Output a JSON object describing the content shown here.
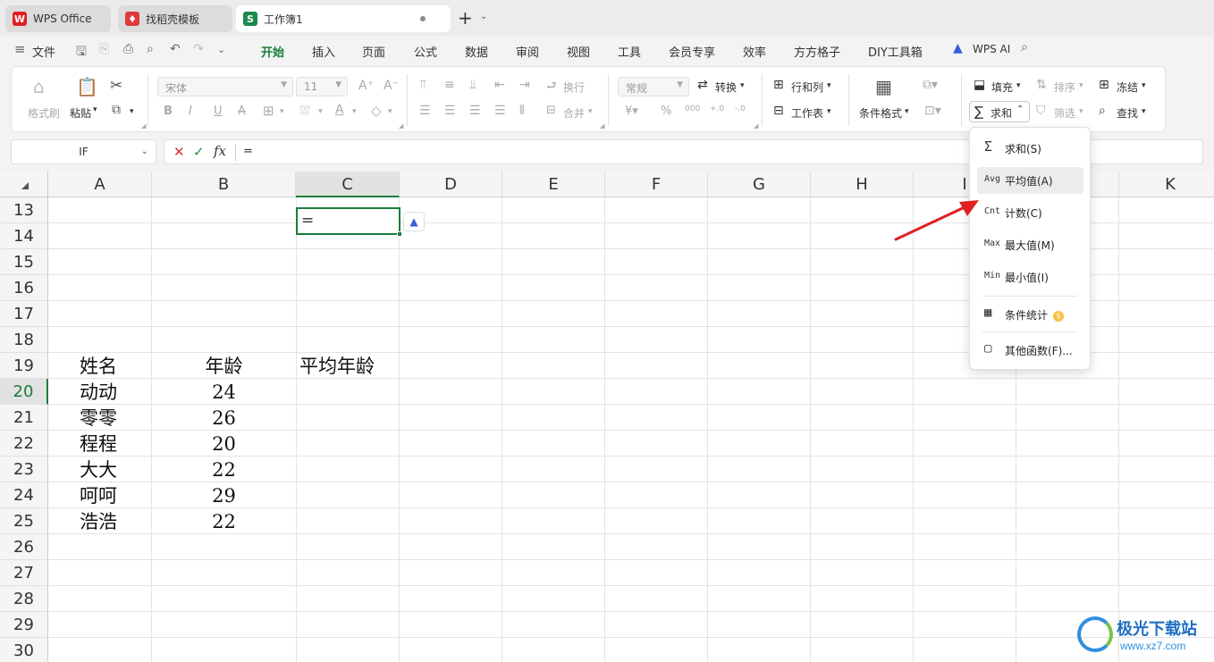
{
  "tabs": [
    {
      "label": "WPS Office",
      "icon": "wps-logo-icon",
      "color": "#e02020"
    },
    {
      "label": "找稻壳模板",
      "icon": "docer-icon",
      "color": "#e03a3a"
    },
    {
      "label": "工作簿1",
      "icon": "spreadsheet-icon",
      "color": "#1a8a4a",
      "icon_text": "S"
    }
  ],
  "menubar": {
    "file": "文件",
    "items": [
      "开始",
      "插入",
      "页面",
      "公式",
      "数据",
      "审阅",
      "视图",
      "工具",
      "会员专享",
      "效率",
      "方方格子",
      "DIY工具箱"
    ],
    "wps_ai": "WPS AI"
  },
  "ribbon": {
    "format_painter": "格式刷",
    "paste": "粘贴",
    "font_name": "宋体",
    "font_size": "11",
    "wrap": "换行",
    "merge": "合并",
    "number_format": "常规",
    "convert": "转换",
    "rows_cols": "行和列",
    "worksheet": "工作表",
    "cond_format": "条件格式",
    "fill": "填充",
    "sort": "排序",
    "freeze": "冻结",
    "sum": "求和",
    "filter": "筛选",
    "find": "查找"
  },
  "formula": {
    "namebox": "IF",
    "value": "=",
    "fx": "fx"
  },
  "columns": [
    "A",
    "B",
    "C",
    "D",
    "E",
    "F",
    "G",
    "H",
    "I",
    "",
    "K"
  ],
  "rows": [
    "13",
    "14",
    "15",
    "16",
    "17",
    "18",
    "19",
    "20",
    "21",
    "22",
    "23",
    "24",
    "25",
    "26",
    "27",
    "28",
    "29",
    "30"
  ],
  "cells": {
    "A19": "姓名",
    "B19": "年龄",
    "C19": "平均年龄",
    "A20": "动动",
    "B20": "24",
    "A21": "零零",
    "B21": "26",
    "A22": "程程",
    "B22": "20",
    "A23": "大大",
    "B23": "22",
    "A24": "呵呵",
    "B24": "29",
    "A25": "浩浩",
    "B25": "22",
    "C20": "="
  },
  "dropdown": [
    {
      "tag": "Σ",
      "label": "求和(S)"
    },
    {
      "tag": "Avg",
      "label": "平均值(A)"
    },
    {
      "tag": "Cnt",
      "label": "计数(C)"
    },
    {
      "tag": "Max",
      "label": "最大值(M)"
    },
    {
      "tag": "Min",
      "label": "最小值(I)"
    },
    {
      "tag": "▦",
      "label": "条件统计"
    },
    {
      "tag": "▢",
      "label": "其他函数(F)..."
    }
  ],
  "watermark": {
    "title": "极光下载站",
    "url": "www.xz7.com"
  },
  "colors": {
    "accent": "#1a7e3c",
    "arrow": "#e02020"
  }
}
